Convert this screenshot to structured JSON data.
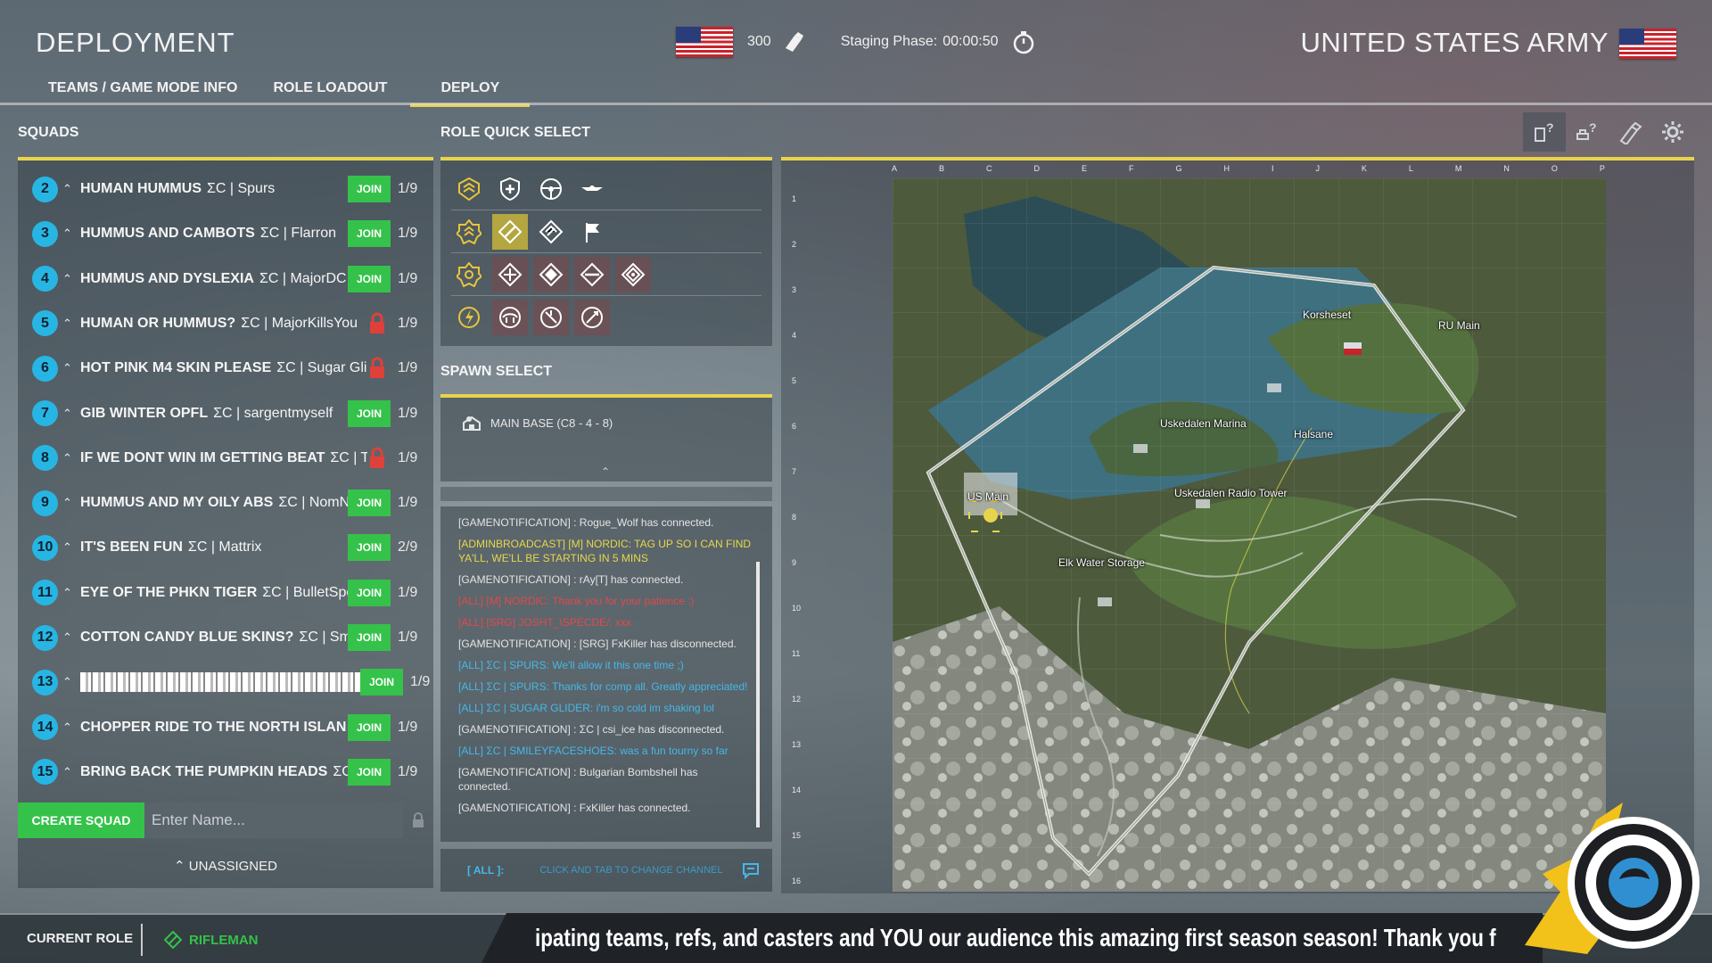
{
  "header": {
    "title": "DEPLOYMENT",
    "tickets": "300",
    "staging_label": "Staging Phase:",
    "staging_time": "00:00:50",
    "army_name": "UNITED STATES ARMY",
    "tabs": [
      {
        "label": "TEAMS / GAME MODE INFO",
        "active": false
      },
      {
        "label": "ROLE LOADOUT",
        "active": false
      },
      {
        "label": "DEPLOY",
        "active": true
      }
    ]
  },
  "squads": {
    "title": "SQUADS",
    "items": [
      {
        "num": "2",
        "name": "HUMAN HUMMUS",
        "leader": "ΣC | Spurs",
        "action": "JOIN",
        "locked": false,
        "count": "1/9"
      },
      {
        "num": "3",
        "name": "HUMMUS AND CAMBOTS",
        "leader": "ΣC | Flarron",
        "action": "JOIN",
        "locked": false,
        "count": "1/9"
      },
      {
        "num": "4",
        "name": "HUMMUS AND DYSLEXIA",
        "leader": "ΣC | MajorDC",
        "action": "JOIN",
        "locked": false,
        "count": "1/9"
      },
      {
        "num": "5",
        "name": "HUMAN OR HUMMUS?",
        "leader": "ΣC | MajorKillsYou",
        "action": "",
        "locked": true,
        "count": "1/9"
      },
      {
        "num": "6",
        "name": "HOT PINK M4 SKIN PLEASE",
        "leader": "ΣC | Sugar Glide",
        "action": "",
        "locked": true,
        "count": "1/9"
      },
      {
        "num": "7",
        "name": "GIB WINTER OPFL",
        "leader": "ΣC | sargentmyself",
        "action": "JOIN",
        "locked": false,
        "count": "1/9"
      },
      {
        "num": "8",
        "name": "IF WE DONT WIN IM GETTING BEAT",
        "leader": "ΣC | Th",
        "action": "",
        "locked": true,
        "count": "1/9"
      },
      {
        "num": "9",
        "name": "HUMMUS AND MY OILY ABS",
        "leader": "ΣC | NomNo",
        "action": "JOIN",
        "locked": false,
        "count": "1/9"
      },
      {
        "num": "10",
        "name": "IT'S BEEN FUN",
        "leader": "ΣC | Mattrix",
        "action": "JOIN",
        "locked": false,
        "count": "2/9"
      },
      {
        "num": "11",
        "name": "EYE OF THE PHKN TIGER",
        "leader": "ΣC | BulletSpong",
        "action": "JOIN",
        "locked": false,
        "count": "1/9"
      },
      {
        "num": "12",
        "name": "COTTON CANDY BLUE SKINS?",
        "leader": "ΣC | Smile",
        "action": "JOIN",
        "locked": false,
        "count": "1/9"
      },
      {
        "num": "13",
        "name": "",
        "leader": "",
        "action": "JOIN",
        "locked": false,
        "count": "1/9",
        "censored": true
      },
      {
        "num": "14",
        "name": "CHOPPER RIDE TO THE NORTH ISLAN",
        "leader": "ΣC",
        "action": "JOIN",
        "locked": false,
        "count": "1/9"
      },
      {
        "num": "15",
        "name": "BRING BACK THE PUMPKIN HEADS",
        "leader": "ΣC | u",
        "action": "JOIN",
        "locked": false,
        "count": "1/9"
      }
    ],
    "create_label": "CREATE SQUAD",
    "name_placeholder": "Enter Name...",
    "unassigned_label": "UNASSIGNED"
  },
  "roles": {
    "title": "ROLE QUICK SELECT",
    "selected_role": "rifleman"
  },
  "spawn": {
    "title": "SPAWN SELECT",
    "items": [
      {
        "label": "MAIN BASE (C8 - 4 - 8)"
      }
    ]
  },
  "chat": {
    "messages": [
      {
        "type": "notif",
        "text": "[GAMENOTIFICATION] : Rogue_Wolf has connected."
      },
      {
        "type": "admin",
        "text": "[ADMINBROADCAST] [M] NORDIC: TAG UP SO I CAN FIND YA'LL, WE'LL BE STARTING IN 5 MINS"
      },
      {
        "type": "notif",
        "text": "[GAMENOTIFICATION] : rAy[T] has connected."
      },
      {
        "type": "red",
        "text": "[ALL] [M] NORDIC: Thank you for your patience :)"
      },
      {
        "type": "red",
        "text": "[ALL] [SRG] JOSHT_\\SPECDE/: xxx"
      },
      {
        "type": "notif",
        "text": "[GAMENOTIFICATION] : [SRG] FxKiller has disconnected."
      },
      {
        "type": "blue",
        "text": "[ALL] ΣC | SPURS: We'll allow it this one time ;)"
      },
      {
        "type": "blue",
        "text": "[ALL] ΣC | SPURS: Thanks for comp all. Greatly appreciated!"
      },
      {
        "type": "blue",
        "text": "[ALL] ΣC | SUGAR GLIDER: i'm so cold im shaking lol"
      },
      {
        "type": "notif",
        "text": "[GAMENOTIFICATION] : ΣC | csi_ice has disconnected."
      },
      {
        "type": "blue",
        "text": "[ALL] ΣC | SMILEYFACESHOES: was a fun tourny so far"
      },
      {
        "type": "notif",
        "text": "[GAMENOTIFICATION] : Bulgarian Bombshell has connected."
      },
      {
        "type": "notif",
        "text": "[GAMENOTIFICATION] : FxKiller has connected."
      }
    ],
    "channel": "[ ALL ]:",
    "hint": "CLICK AND TAB TO CHANGE CHANNEL"
  },
  "map": {
    "columns": [
      "A",
      "B",
      "C",
      "D",
      "E",
      "F",
      "G",
      "H",
      "I",
      "J",
      "K",
      "L",
      "M",
      "N",
      "O",
      "P"
    ],
    "rows": [
      "1",
      "2",
      "3",
      "4",
      "5",
      "6",
      "7",
      "8",
      "9",
      "10",
      "11",
      "12",
      "13",
      "14",
      "15",
      "16"
    ],
    "labels": {
      "korsheset": "Korsheset",
      "ru_main": "RU Main",
      "uskedalen_marina": "Uskedalen Marina",
      "halsane": "Halsane",
      "uskedalen_radio_tower": "Uskedalen Radio Tower",
      "us_main": "US Main",
      "elk_water_storage": "Elk Water Storage"
    }
  },
  "bottom": {
    "current_role_label": "CURRENT ROLE",
    "current_role": "RIFLEMAN",
    "ticker": "ipating teams, refs, and casters and YOU our audience this amazing first season season! Thank you f"
  },
  "colors": {
    "accent_yellow": "#e8d44a",
    "join_green": "#35c24a",
    "squad_blue": "#27b6e3",
    "chat_blue": "#45b8e8",
    "chat_red": "#e04a4a",
    "admin_yellow": "#e6d84a"
  }
}
